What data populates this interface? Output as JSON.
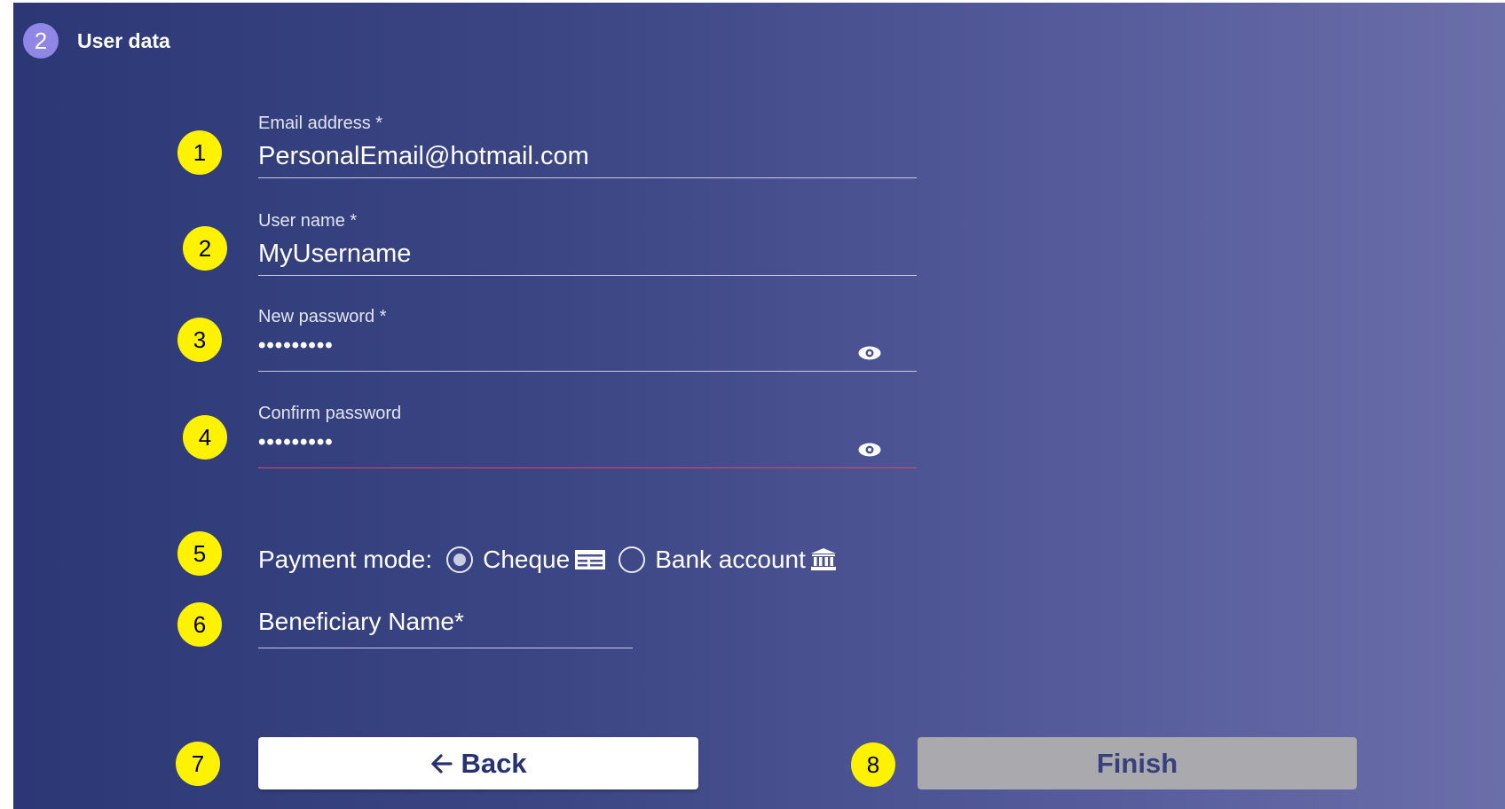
{
  "step": {
    "number": "2",
    "title": "User data"
  },
  "markers": [
    "1",
    "2",
    "3",
    "4",
    "5",
    "6",
    "7",
    "8"
  ],
  "fields": {
    "email": {
      "label": "Email address *",
      "value": "PersonalEmail@hotmail.com"
    },
    "username": {
      "label": "User name *",
      "value": "MyUsername"
    },
    "new_password": {
      "label": "New password *",
      "value": "•••••••••",
      "icon": "eye-icon"
    },
    "confirm_password": {
      "label": "Confirm password",
      "value": "•••••••••",
      "icon": "eye-icon"
    }
  },
  "payment": {
    "label": "Payment mode:",
    "options": [
      {
        "label": "Cheque",
        "selected": true,
        "icon": "cheque-icon"
      },
      {
        "label": "Bank account",
        "selected": false,
        "icon": "bank-icon"
      }
    ]
  },
  "beneficiary": {
    "placeholder": "Beneficiary Name*"
  },
  "buttons": {
    "back": "Back",
    "finish": "Finish",
    "back_icon": "arrow-left-icon"
  },
  "colors": {
    "marker": "#fff200",
    "step_badge": "#8f86e6",
    "error_underline": "#e0475a",
    "finish_disabled": "#a9a9ae",
    "gradient_start": "#2c3876",
    "gradient_end": "#6b6ea9"
  }
}
